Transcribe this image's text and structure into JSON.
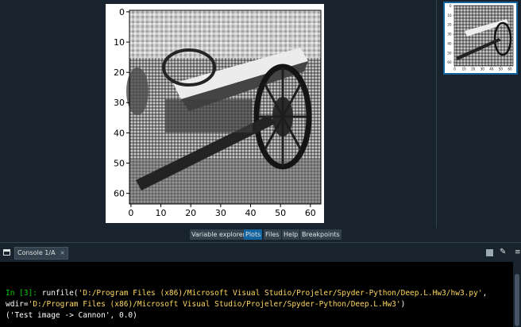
{
  "plot": {
    "x_ticks": [
      "0",
      "10",
      "20",
      "30",
      "40",
      "50",
      "60"
    ],
    "y_ticks": [
      "0",
      "10",
      "20",
      "30",
      "40",
      "50",
      "60"
    ]
  },
  "thumbnail": {
    "x_ticks": [
      "0",
      "10",
      "20",
      "30",
      "40",
      "50",
      "60"
    ],
    "y_ticks": [
      "0",
      "10",
      "20",
      "30",
      "40",
      "50",
      "60"
    ]
  },
  "pane_tabs": [
    {
      "label": "Variable explorer",
      "active": false
    },
    {
      "label": "Plots",
      "active": true
    },
    {
      "label": "Files",
      "active": false
    },
    {
      "label": "Help",
      "active": false
    },
    {
      "label": "Breakpoints",
      "active": false
    }
  ],
  "console": {
    "tab_label": "Console 1/A",
    "close_glyph": "×",
    "prompt": "In [3]:",
    "cmd_func": " runfile(",
    "cmd_path": "'D:/Program Files (x86)/Microsoft Visual Studio/Projeler/Spyder-Python/Deep.L.Hw3/hw3.py'",
    "cmd_sep": ",",
    "wdir_label": "wdir=",
    "wdir_path": "'D:/Program Files (x86)/Microsoft Visual Studio/Projeler/Spyder-Python/Deep.L.Hw3'",
    "wdir_close": ")",
    "output": "('Test image -> Cannon', 0.0)"
  },
  "icons": {
    "console": "console-icon",
    "stop": "stop-icon",
    "clear": "clear-console-icon",
    "menu": "options-menu-icon"
  },
  "colors": {
    "background": "#19232d",
    "border": "#32414b",
    "accent": "#1464a0",
    "prompt": "#00cc00",
    "string": "#ffd75f",
    "console_bg": "#000000"
  }
}
